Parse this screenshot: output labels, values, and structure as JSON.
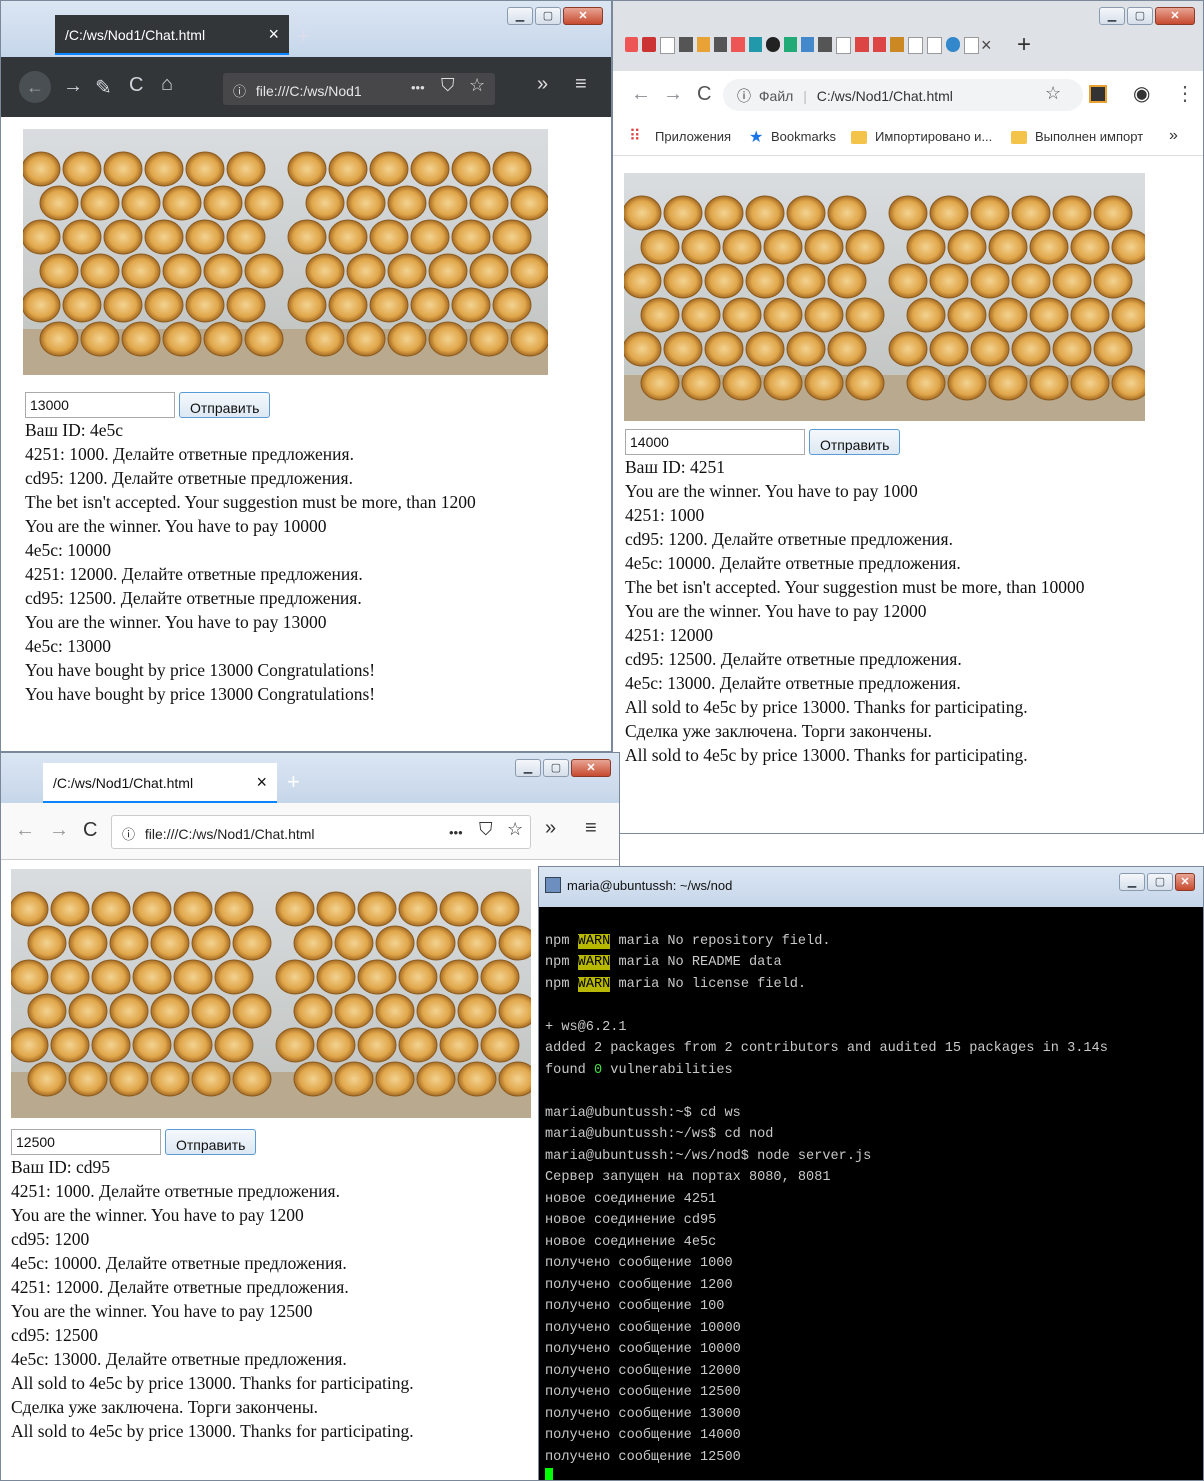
{
  "colors": {
    "firefox_dark": "#323639",
    "firefox_light": "#e8e8ea",
    "chrome_bg": "#dee1e6",
    "terminal_bg": "#000000",
    "cursor": "#00ff00",
    "warn_bg": "#b8b800"
  },
  "win1": {
    "tab_title": "/C:/ws/Nod1/Chat.html",
    "tab_close": "×",
    "new_tab": "+",
    "url": "file:///C:/ws/Nod1",
    "more": "•••",
    "overflow": "»",
    "menu": "≡",
    "input_value": "13000",
    "send_label": "Отправить",
    "messages": [
      "Ваш ID: 4e5c",
      "4251: 1000. Делайте ответные предложения.",
      "cd95: 1200. Делайте ответные предложения.",
      "The bet isn't accepted. Your suggestion must be more, than 1200",
      "You are the winner. You have to pay 10000",
      "4e5c: 10000",
      "4251: 12000. Делайте ответные предложения.",
      "cd95: 12500. Делайте ответные предложения.",
      "You are the winner. You have to pay 13000",
      "4e5c: 13000",
      "You have bought by price 13000 Congratulations!",
      "You have bought by price 13000 Congratulations!"
    ]
  },
  "win2": {
    "tab_close": "×",
    "new_tab": "+",
    "url_prefix": "Файл",
    "url": "C:/ws/Nod1/Chat.html",
    "bookmarks": [
      "Приложения",
      "Bookmarks",
      "Импортировано и...",
      "Выполнен импорт"
    ],
    "bookmarks_more": "»",
    "input_value": "14000",
    "send_label": "Отправить",
    "messages": [
      "Ваш ID: 4251",
      "You are the winner. You have to pay 1000",
      "4251: 1000",
      "cd95: 1200. Делайте ответные предложения.",
      "4e5c: 10000. Делайте ответные предложения.",
      "The bet isn't accepted. Your suggestion must be more, than 10000",
      "You are the winner. You have to pay 12000",
      "4251: 12000",
      "cd95: 12500. Делайте ответные предложения.",
      "4e5c: 13000. Делайте ответные предложения.",
      "All sold to 4e5c by price 13000. Thanks for participating.",
      "Сделка уже заключена. Торги закончены.",
      "All sold to 4e5c by price 13000. Thanks for participating."
    ]
  },
  "win3": {
    "tab_title": "/C:/ws/Nod1/Chat.html",
    "tab_close": "×",
    "new_tab": "+",
    "url": "file:///C:/ws/Nod1/Chat.html",
    "more": "•••",
    "overflow": "»",
    "menu": "≡",
    "input_value": "12500",
    "send_label": "Отправить",
    "messages": [
      "Ваш ID: cd95",
      "4251: 1000. Делайте ответные предложения.",
      "You are the winner. You have to pay 1200",
      "cd95: 1200",
      "4e5c: 10000. Делайте ответные предложения.",
      "4251: 12000. Делайте ответные предложения.",
      "You are the winner. You have to pay 12500",
      "cd95: 12500",
      "4e5c: 13000. Делайте ответные предложения.",
      "All sold to 4e5c by price 13000. Thanks for participating.",
      "Сделка уже заключена. Торги закончены.",
      "All sold to 4e5c by price 13000. Thanks for participating."
    ]
  },
  "terminal": {
    "title": "maria@ubuntussh: ~/ws/nod",
    "npm": "npm",
    "warn": "WARN",
    "warn_lines": [
      " maria No repository field.",
      " maria No README data",
      " maria No license field."
    ],
    "pkg": "+ ws@6.2.1",
    "added": "added 2 packages from 2 contributors and audited 15 packages in 3.14s",
    "found_prefix": "found ",
    "found_zero": "0",
    "found_suffix": " vulnerabilities",
    "lines": [
      "maria@ubuntussh:~$ cd ws",
      "maria@ubuntussh:~/ws$ cd nod",
      "maria@ubuntussh:~/ws/nod$ node server.js",
      "Сервер запущен на портах 8080, 8081",
      "новое соединение 4251",
      "новое соединение cd95",
      "новое соединение 4e5c",
      "получено сообщение 1000",
      "получено сообщение 1200",
      "получено сообщение 100",
      "получено сообщение 10000",
      "получено сообщение 10000",
      "получено сообщение 12000",
      "получено сообщение 12500",
      "получено сообщение 13000",
      "получено сообщение 14000",
      "получено сообщение 12500"
    ]
  }
}
